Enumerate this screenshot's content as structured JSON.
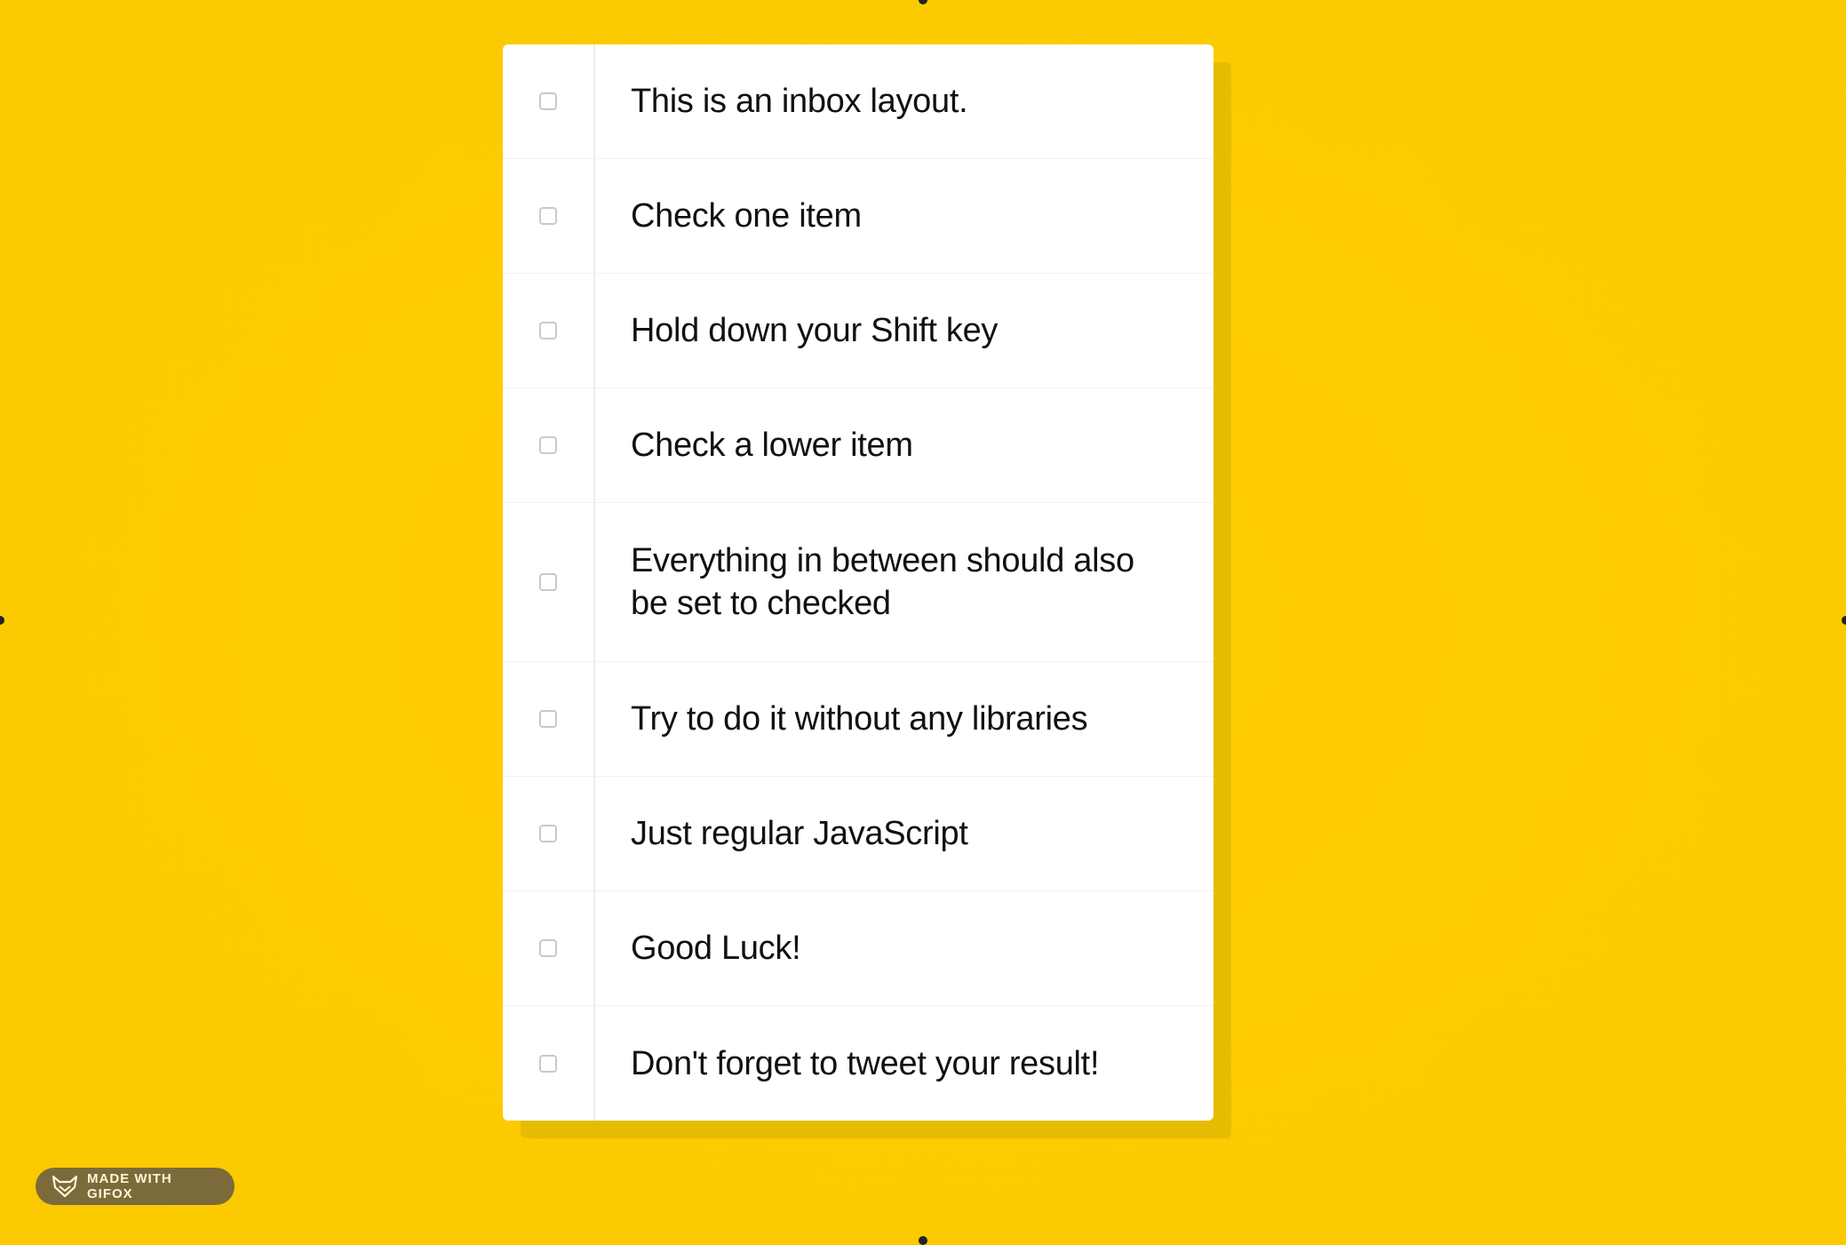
{
  "inbox": {
    "items": [
      {
        "label": "This is an inbox layout.",
        "checked": false
      },
      {
        "label": "Check one item",
        "checked": false
      },
      {
        "label": "Hold down your Shift key",
        "checked": false
      },
      {
        "label": "Check a lower item",
        "checked": false
      },
      {
        "label": "Everything in between should also be set to checked",
        "checked": false
      },
      {
        "label": "Try to do it without any libraries",
        "checked": false
      },
      {
        "label": "Just regular JavaScript",
        "checked": false
      },
      {
        "label": "Good Luck!",
        "checked": false
      },
      {
        "label": "Don't forget to tweet your result!",
        "checked": false
      }
    ]
  },
  "badge": {
    "label": "MADE WITH GIFOX",
    "icon": "fox-icon"
  },
  "colors": {
    "background": "#FDCC01",
    "card": "#FFFFFF",
    "shadow": "#E6BC02",
    "badge": "#7C6B3A"
  }
}
